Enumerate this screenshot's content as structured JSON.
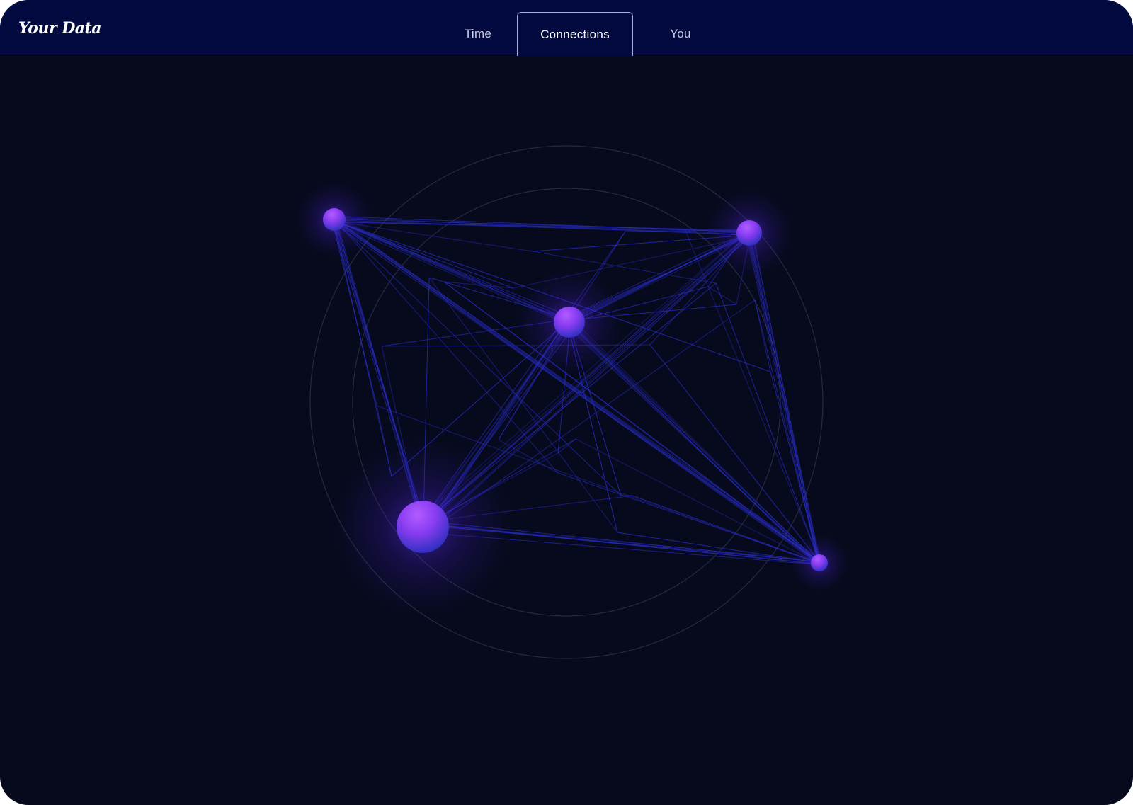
{
  "app": {
    "title": "Your Data"
  },
  "tabs": [
    {
      "label": "Time",
      "active": false
    },
    {
      "label": "Connections",
      "active": true
    },
    {
      "label": "You",
      "active": false
    }
  ],
  "colors": {
    "background": "#070a1d",
    "header": "#020a40",
    "edge": "#2a2fd0",
    "node_top": "#a24dff",
    "node_bottom": "#2b2fbe",
    "ring": "#2a2e44"
  }
}
